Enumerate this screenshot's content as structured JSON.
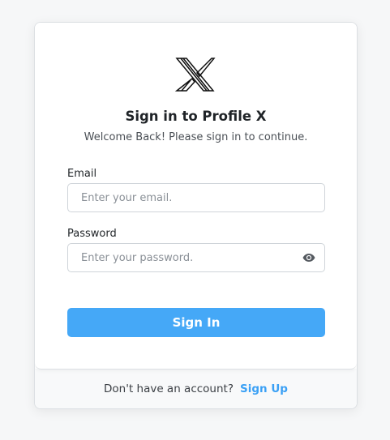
{
  "logo": {
    "icon": "profile-x-logo-icon"
  },
  "header": {
    "title": "Sign in to Profile X",
    "subtitle": "Welcome Back! Please sign in to continue."
  },
  "form": {
    "email": {
      "label": "Email",
      "placeholder": "Enter your email.",
      "value": ""
    },
    "password": {
      "label": "Password",
      "placeholder": "Enter your password.",
      "value": "",
      "toggle_icon": "eye-icon"
    },
    "submit_label": "Sign In"
  },
  "footer": {
    "prompt": "Don't have an account?",
    "link_label": "Sign Up"
  },
  "colors": {
    "accent": "#45a8f7",
    "link": "#3aa0f5",
    "background": "#f6f7f8",
    "footer_bg": "#f8f9fa"
  }
}
